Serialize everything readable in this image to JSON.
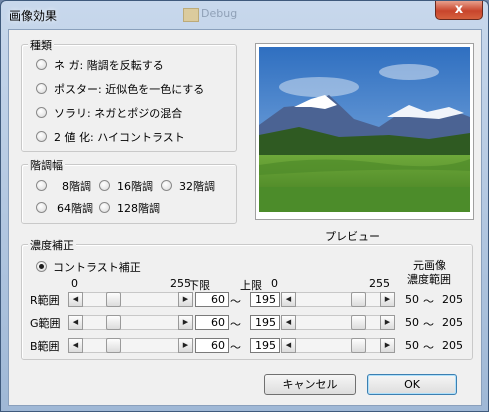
{
  "window": {
    "title": "画像効果",
    "background_item": "Debug",
    "close_label": "x"
  },
  "type_group": {
    "label": "種類",
    "options": [
      "ネ ガ: 階調を反転する",
      "ポスター: 近似色を一色にする",
      "ソラリ: ネガとポジの混合",
      "2 値 化: ハイコントラスト"
    ]
  },
  "tone_group": {
    "label": "階調幅",
    "options": [
      "8階調",
      "16階調",
      "32階調",
      "64階調",
      "128階調"
    ]
  },
  "preview": {
    "label": "プレビュー"
  },
  "density_group": {
    "label": "濃度補正",
    "contrast_label": "コントラスト補正",
    "min_label": "0",
    "max_label": "255",
    "lower_label": "下限",
    "upper_label": "上限",
    "upper_min": "0",
    "upper_max": "255",
    "orig_label_1": "元画像",
    "orig_label_2": "濃度範囲",
    "tilde": "～",
    "rows": [
      {
        "label": "R範囲",
        "lower": "60",
        "upper": "195",
        "range_lo": "50",
        "range_hi": "205"
      },
      {
        "label": "G範囲",
        "lower": "60",
        "upper": "195",
        "range_lo": "50",
        "range_hi": "205"
      },
      {
        "label": "B範囲",
        "lower": "60",
        "upper": "195",
        "range_lo": "50",
        "range_hi": "205"
      }
    ]
  },
  "buttons": {
    "cancel": "キャンセル",
    "ok": "OK"
  },
  "colors": {
    "sky": "#3c79c4",
    "mountain": "#4d6aa8",
    "grass": "#5c9a33"
  }
}
